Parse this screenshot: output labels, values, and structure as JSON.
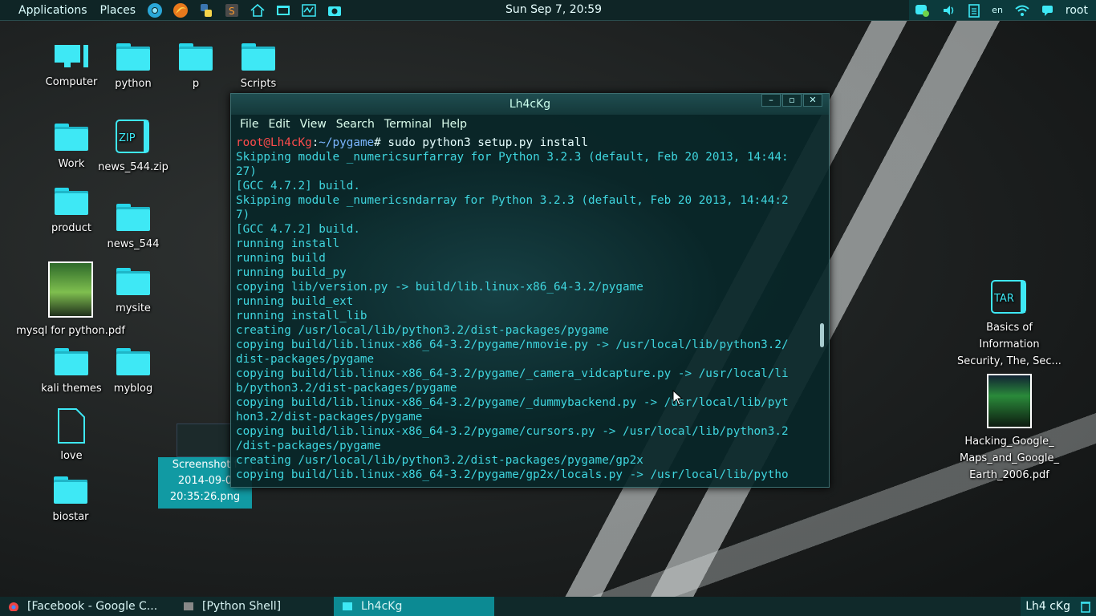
{
  "top_panel": {
    "applications": "Applications",
    "places": "Places",
    "launchers": [
      "chromium-icon",
      "firefox-icon",
      "python-icon",
      "sublime-icon",
      "home-icon",
      "file-manager-icon",
      "system-monitor-icon",
      "camera-icon"
    ],
    "clock": "Sun Sep  7, 20:59",
    "language": "en",
    "user": "root"
  },
  "desktop_icons_left": [
    {
      "label": "Computer",
      "type": "computer"
    },
    {
      "label": "python",
      "type": "folder"
    },
    {
      "label": "p",
      "type": "folder"
    },
    {
      "label": "Scripts",
      "type": "folder"
    },
    {
      "label": "Work",
      "type": "folder"
    },
    {
      "label": "news_544.zip",
      "type": "zip"
    },
    {
      "label": "product",
      "type": "folder"
    },
    {
      "label": "news_544",
      "type": "folder"
    },
    {
      "label": "mysql for python.pdf",
      "type": "pdf"
    },
    {
      "label": "mysite",
      "type": "folder"
    },
    {
      "label": "kali themes",
      "type": "folder"
    },
    {
      "label": "myblog",
      "type": "folder"
    },
    {
      "label": "love",
      "type": "file"
    },
    {
      "label": "biostar",
      "type": "folder"
    }
  ],
  "screenshot_icon": {
    "line1": "Screenshot f",
    "line2": "2014-09-0",
    "line3": "20:35:26.png"
  },
  "desktop_icons_right": [
    {
      "label_lines": [
        "Basics of",
        "Information",
        "Security, The, Sec..."
      ],
      "type": "tar",
      "badge": "TAR"
    },
    {
      "label_lines": [
        "Hacking_Google_",
        "Maps_and_Google_",
        "Earth_2006.pdf"
      ],
      "type": "pdf"
    }
  ],
  "zip_badge": "ZIP",
  "terminal": {
    "title": "Lh4cKg",
    "menu": [
      "File",
      "Edit",
      "View",
      "Search",
      "Terminal",
      "Help"
    ],
    "prompt_user": "root@Lh4cKg",
    "prompt_sep": ":",
    "prompt_path": "~/pygame",
    "prompt_cmd": "# sudo python3 setup.py install",
    "lines": [
      "Skipping module _numericsurfarray for Python 3.2.3 (default, Feb 20 2013, 14:44:",
      "27)",
      "[GCC 4.7.2] build.",
      "Skipping module _numericsndarray for Python 3.2.3 (default, Feb 20 2013, 14:44:2",
      "7)",
      "[GCC 4.7.2] build.",
      "running install",
      "running build",
      "running build_py",
      "copying lib/version.py -> build/lib.linux-x86_64-3.2/pygame",
      "running build_ext",
      "running install_lib",
      "creating /usr/local/lib/python3.2/dist-packages/pygame",
      "copying build/lib.linux-x86_64-3.2/pygame/nmovie.py -> /usr/local/lib/python3.2/",
      "dist-packages/pygame",
      "copying build/lib.linux-x86_64-3.2/pygame/_camera_vidcapture.py -> /usr/local/li",
      "b/python3.2/dist-packages/pygame",
      "copying build/lib.linux-x86_64-3.2/pygame/_dummybackend.py -> /usr/local/lib/pyt",
      "hon3.2/dist-packages/pygame",
      "copying build/lib.linux-x86_64-3.2/pygame/cursors.py -> /usr/local/lib/python3.2",
      "/dist-packages/pygame",
      "creating /usr/local/lib/python3.2/dist-packages/pygame/gp2x",
      "copying build/lib.linux-x86_64-3.2/pygame/gp2x/locals.py -> /usr/local/lib/pytho"
    ]
  },
  "taskbar": {
    "tasks": [
      {
        "label": "[Facebook - Google C...",
        "icon": "chrome-icon",
        "active": false
      },
      {
        "label": "[Python Shell]",
        "icon": "window-icon",
        "active": false
      },
      {
        "label": "Lh4cKg",
        "icon": "terminal-icon",
        "active": true
      }
    ],
    "workspace": "Lh4 cKg"
  },
  "colors": {
    "accent": "#3ee8f5",
    "prompt_user": "#ff4c4c",
    "prompt_path": "#7bb6ff",
    "terminal_text": "#3fd6df",
    "active_task": "#0c8a93"
  }
}
